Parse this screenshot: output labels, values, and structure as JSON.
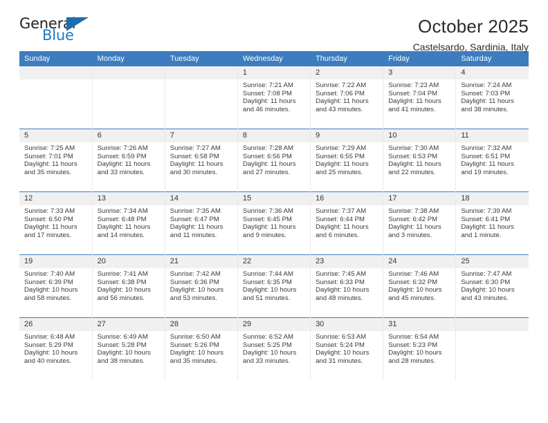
{
  "brand": {
    "name_top": "General",
    "name_bottom": "Blue",
    "accent_color": "#1f7bc1",
    "triangle_color": "#1f6cb0"
  },
  "header": {
    "title": "October 2025",
    "location": "Castelsardo, Sardinia, Italy"
  },
  "calendar": {
    "header_bg": "#3c7cbf",
    "header_text_color": "#ffffff",
    "daynum_bg": "#f0f0f0",
    "weekdays": [
      "Sunday",
      "Monday",
      "Tuesday",
      "Wednesday",
      "Thursday",
      "Friday",
      "Saturday"
    ],
    "weeks": [
      [
        {
          "day": "",
          "empty": true
        },
        {
          "day": "",
          "empty": true
        },
        {
          "day": "",
          "empty": true
        },
        {
          "day": "1",
          "sunrise": "Sunrise: 7:21 AM",
          "sunset": "Sunset: 7:08 PM",
          "daylight": "Daylight: 11 hours and 46 minutes."
        },
        {
          "day": "2",
          "sunrise": "Sunrise: 7:22 AM",
          "sunset": "Sunset: 7:06 PM",
          "daylight": "Daylight: 11 hours and 43 minutes."
        },
        {
          "day": "3",
          "sunrise": "Sunrise: 7:23 AM",
          "sunset": "Sunset: 7:04 PM",
          "daylight": "Daylight: 11 hours and 41 minutes."
        },
        {
          "day": "4",
          "sunrise": "Sunrise: 7:24 AM",
          "sunset": "Sunset: 7:03 PM",
          "daylight": "Daylight: 11 hours and 38 minutes."
        }
      ],
      [
        {
          "day": "5",
          "sunrise": "Sunrise: 7:25 AM",
          "sunset": "Sunset: 7:01 PM",
          "daylight": "Daylight: 11 hours and 35 minutes."
        },
        {
          "day": "6",
          "sunrise": "Sunrise: 7:26 AM",
          "sunset": "Sunset: 6:59 PM",
          "daylight": "Daylight: 11 hours and 33 minutes."
        },
        {
          "day": "7",
          "sunrise": "Sunrise: 7:27 AM",
          "sunset": "Sunset: 6:58 PM",
          "daylight": "Daylight: 11 hours and 30 minutes."
        },
        {
          "day": "8",
          "sunrise": "Sunrise: 7:28 AM",
          "sunset": "Sunset: 6:56 PM",
          "daylight": "Daylight: 11 hours and 27 minutes."
        },
        {
          "day": "9",
          "sunrise": "Sunrise: 7:29 AM",
          "sunset": "Sunset: 6:55 PM",
          "daylight": "Daylight: 11 hours and 25 minutes."
        },
        {
          "day": "10",
          "sunrise": "Sunrise: 7:30 AM",
          "sunset": "Sunset: 6:53 PM",
          "daylight": "Daylight: 11 hours and 22 minutes."
        },
        {
          "day": "11",
          "sunrise": "Sunrise: 7:32 AM",
          "sunset": "Sunset: 6:51 PM",
          "daylight": "Daylight: 11 hours and 19 minutes."
        }
      ],
      [
        {
          "day": "12",
          "sunrise": "Sunrise: 7:33 AM",
          "sunset": "Sunset: 6:50 PM",
          "daylight": "Daylight: 11 hours and 17 minutes."
        },
        {
          "day": "13",
          "sunrise": "Sunrise: 7:34 AM",
          "sunset": "Sunset: 6:48 PM",
          "daylight": "Daylight: 11 hours and 14 minutes."
        },
        {
          "day": "14",
          "sunrise": "Sunrise: 7:35 AM",
          "sunset": "Sunset: 6:47 PM",
          "daylight": "Daylight: 11 hours and 11 minutes."
        },
        {
          "day": "15",
          "sunrise": "Sunrise: 7:36 AM",
          "sunset": "Sunset: 6:45 PM",
          "daylight": "Daylight: 11 hours and 9 minutes."
        },
        {
          "day": "16",
          "sunrise": "Sunrise: 7:37 AM",
          "sunset": "Sunset: 6:44 PM",
          "daylight": "Daylight: 11 hours and 6 minutes."
        },
        {
          "day": "17",
          "sunrise": "Sunrise: 7:38 AM",
          "sunset": "Sunset: 6:42 PM",
          "daylight": "Daylight: 11 hours and 3 minutes."
        },
        {
          "day": "18",
          "sunrise": "Sunrise: 7:39 AM",
          "sunset": "Sunset: 6:41 PM",
          "daylight": "Daylight: 11 hours and 1 minute."
        }
      ],
      [
        {
          "day": "19",
          "sunrise": "Sunrise: 7:40 AM",
          "sunset": "Sunset: 6:39 PM",
          "daylight": "Daylight: 10 hours and 58 minutes."
        },
        {
          "day": "20",
          "sunrise": "Sunrise: 7:41 AM",
          "sunset": "Sunset: 6:38 PM",
          "daylight": "Daylight: 10 hours and 56 minutes."
        },
        {
          "day": "21",
          "sunrise": "Sunrise: 7:42 AM",
          "sunset": "Sunset: 6:36 PM",
          "daylight": "Daylight: 10 hours and 53 minutes."
        },
        {
          "day": "22",
          "sunrise": "Sunrise: 7:44 AM",
          "sunset": "Sunset: 6:35 PM",
          "daylight": "Daylight: 10 hours and 51 minutes."
        },
        {
          "day": "23",
          "sunrise": "Sunrise: 7:45 AM",
          "sunset": "Sunset: 6:33 PM",
          "daylight": "Daylight: 10 hours and 48 minutes."
        },
        {
          "day": "24",
          "sunrise": "Sunrise: 7:46 AM",
          "sunset": "Sunset: 6:32 PM",
          "daylight": "Daylight: 10 hours and 45 minutes."
        },
        {
          "day": "25",
          "sunrise": "Sunrise: 7:47 AM",
          "sunset": "Sunset: 6:30 PM",
          "daylight": "Daylight: 10 hours and 43 minutes."
        }
      ],
      [
        {
          "day": "26",
          "sunrise": "Sunrise: 6:48 AM",
          "sunset": "Sunset: 5:29 PM",
          "daylight": "Daylight: 10 hours and 40 minutes."
        },
        {
          "day": "27",
          "sunrise": "Sunrise: 6:49 AM",
          "sunset": "Sunset: 5:28 PM",
          "daylight": "Daylight: 10 hours and 38 minutes."
        },
        {
          "day": "28",
          "sunrise": "Sunrise: 6:50 AM",
          "sunset": "Sunset: 5:26 PM",
          "daylight": "Daylight: 10 hours and 35 minutes."
        },
        {
          "day": "29",
          "sunrise": "Sunrise: 6:52 AM",
          "sunset": "Sunset: 5:25 PM",
          "daylight": "Daylight: 10 hours and 33 minutes."
        },
        {
          "day": "30",
          "sunrise": "Sunrise: 6:53 AM",
          "sunset": "Sunset: 5:24 PM",
          "daylight": "Daylight: 10 hours and 31 minutes."
        },
        {
          "day": "31",
          "sunrise": "Sunrise: 6:54 AM",
          "sunset": "Sunset: 5:23 PM",
          "daylight": "Daylight: 10 hours and 28 minutes."
        },
        {
          "day": "",
          "empty": true
        }
      ]
    ]
  }
}
